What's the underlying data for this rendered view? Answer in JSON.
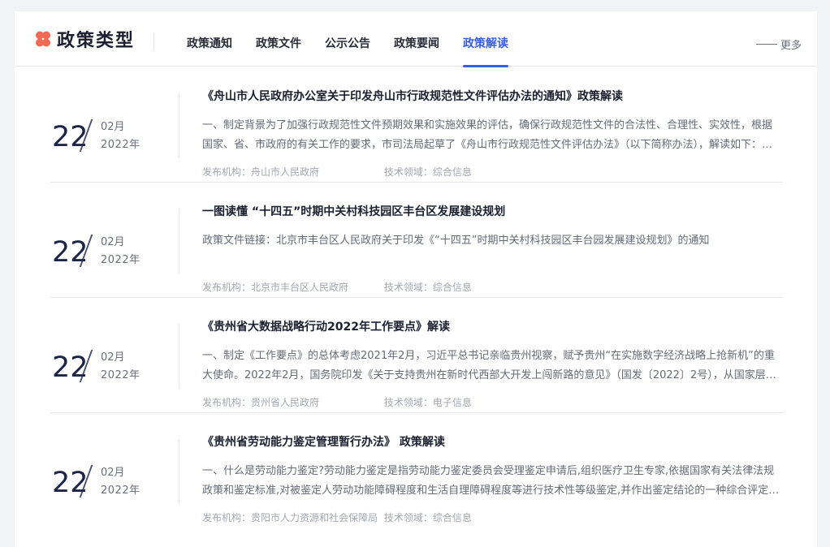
{
  "header": {
    "brand_title": "政策类型",
    "tabs": [
      {
        "label": "政策通知",
        "active": false
      },
      {
        "label": "政策文件",
        "active": false
      },
      {
        "label": "公示公告",
        "active": false
      },
      {
        "label": "政策要闻",
        "active": false
      },
      {
        "label": "政策解读",
        "active": true
      }
    ],
    "more_label": "更多"
  },
  "colors": {
    "accent": "#3a5ee0",
    "brand_icon": "#f26a55",
    "date_text": "#1d2448"
  },
  "items": [
    {
      "day": "22",
      "month": "02月",
      "year": "2022年",
      "title": "《舟山市人民政府办公室关于印发舟山市行政规范性文件评估办法的通知》政策解读",
      "summary": "一、制定背景为了加强行政规范性文件预期效果和实施效果的评估，确保行政规范性文件的合法性、合理性、实效性，根据国家、省、市政府的有关工作的要求，市司法局起草了《舟山市行政规范性文件评估办法》（以下简称办法），解读如下：二、…",
      "agency": "发布机构：舟山市人民政府",
      "domain": "技术领域：综合信息"
    },
    {
      "day": "22",
      "month": "02月",
      "year": "2022年",
      "title": "一图读懂 “十四五”时期中关村科技园区丰台区发展建设规划",
      "summary": "  政策文件链接：北京市丰台区人民政府关于印发《“十四五”时期中关村科技园区丰台园发展建设规划》的通知",
      "agency": "发布机构：北京市丰台区人民政府",
      "domain": "技术领域：综合信息"
    },
    {
      "day": "22",
      "month": "02月",
      "year": "2022年",
      "title": "《贵州省大数据战略行动2022年工作要点》解读",
      "summary": "一、制定《工作要点》的总体考虑2021年2月，习近平总书记亲临贵州视察，赋予贵州“在实施数字经济战略上抢新机”的重大使命。2022年2月，国务院印发《关于支持贵州在新时代西部大开发上闯新路的意见》（国发〔2022〕2号），从国家层面赋予贵…",
      "agency": "发布机构：贵州省人民政府",
      "domain": "技术领域：电子信息"
    },
    {
      "day": "22",
      "month": "02月",
      "year": "2022年",
      "title": "《贵州省劳动能力鉴定管理暂行办法》 政策解读",
      "summary": "一、什么是劳动能力鉴定?劳动能力鉴定是指劳动能力鉴定委员会受理鉴定申请后,组织医疗卫生专家,依据国家有关法律法规政策和鉴定标准,对被鉴定人劳动功能障碍程度和生活自理障碍程度等进行技术性等级鉴定,并作出鉴定结论的一种综合评定制度。二…",
      "agency": "发布机构：贵阳市人力资源和社会保障局",
      "domain": "技术领域：综合信息"
    }
  ]
}
